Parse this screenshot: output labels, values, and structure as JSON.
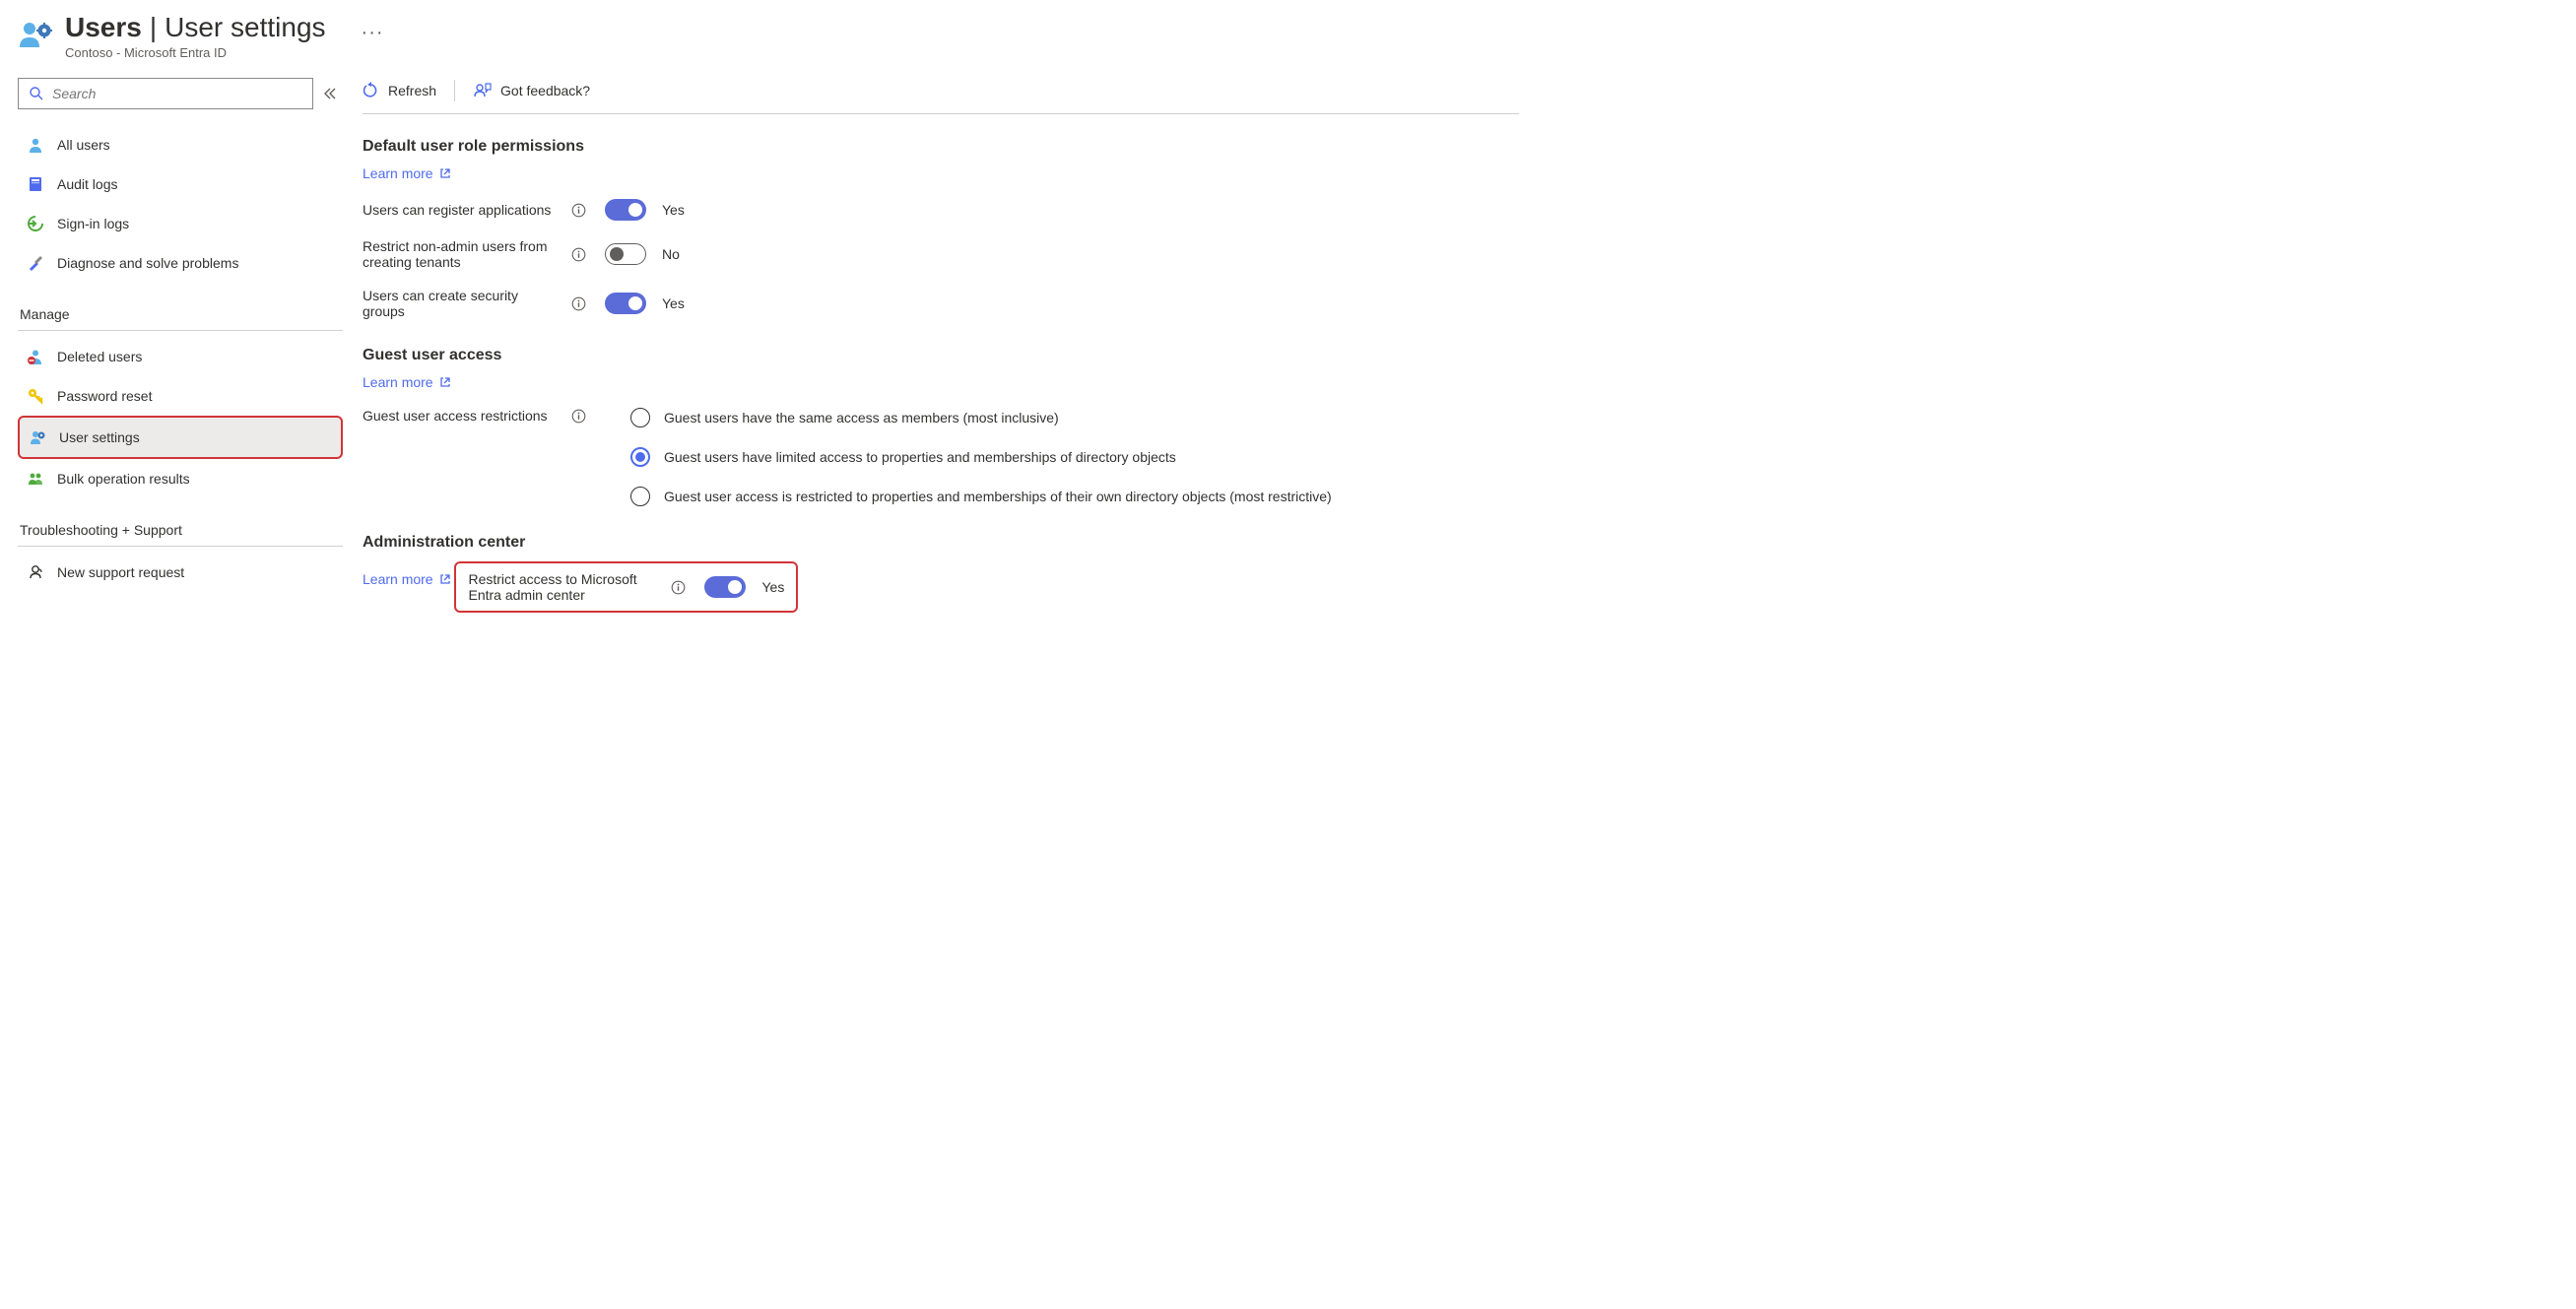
{
  "header": {
    "title_prefix": "Users",
    "title_divider": " | ",
    "title_suffix": "User settings",
    "subtitle": "Contoso - Microsoft Entra ID",
    "more": "···"
  },
  "sidebar": {
    "search_placeholder": "Search",
    "nav": [
      {
        "id": "all-users",
        "label": "All users"
      },
      {
        "id": "audit-logs",
        "label": "Audit logs"
      },
      {
        "id": "signin-logs",
        "label": "Sign-in logs"
      },
      {
        "id": "diagnose",
        "label": "Diagnose and solve problems"
      }
    ],
    "manage_heading": "Manage",
    "manage": [
      {
        "id": "deleted-users",
        "label": "Deleted users"
      },
      {
        "id": "password-reset",
        "label": "Password reset"
      },
      {
        "id": "user-settings",
        "label": "User settings",
        "selected": true,
        "highlighted": true
      },
      {
        "id": "bulk-results",
        "label": "Bulk operation results"
      }
    ],
    "support_heading": "Troubleshooting + Support",
    "support": [
      {
        "id": "new-support",
        "label": "New support request"
      }
    ]
  },
  "cmdbar": {
    "refresh": "Refresh",
    "feedback": "Got feedback?"
  },
  "sections": {
    "default_perms": {
      "title": "Default user role permissions",
      "learn_more": "Learn more",
      "rows": [
        {
          "id": "register-apps",
          "label": "Users can register applications",
          "on": true,
          "state": "Yes"
        },
        {
          "id": "restrict-tenants",
          "label": "Restrict non-admin users from creating tenants",
          "on": false,
          "state": "No"
        },
        {
          "id": "create-groups",
          "label": "Users can create security groups",
          "on": true,
          "state": "Yes"
        }
      ]
    },
    "guest_access": {
      "title": "Guest user access",
      "learn_more": "Learn more",
      "label": "Guest user access restrictions",
      "options": [
        {
          "id": "opt-inclusive",
          "label": "Guest users have the same access as members (most inclusive)",
          "selected": false
        },
        {
          "id": "opt-limited",
          "label": "Guest users have limited access to properties and memberships of directory objects",
          "selected": true
        },
        {
          "id": "opt-restrictive",
          "label": "Guest user access is restricted to properties and memberships of their own directory objects (most restrictive)",
          "selected": false
        }
      ]
    },
    "admin_center": {
      "title": "Administration center",
      "learn_more": "Learn more",
      "row": {
        "label": "Restrict access to Microsoft Entra admin center",
        "on": true,
        "state": "Yes"
      }
    }
  }
}
